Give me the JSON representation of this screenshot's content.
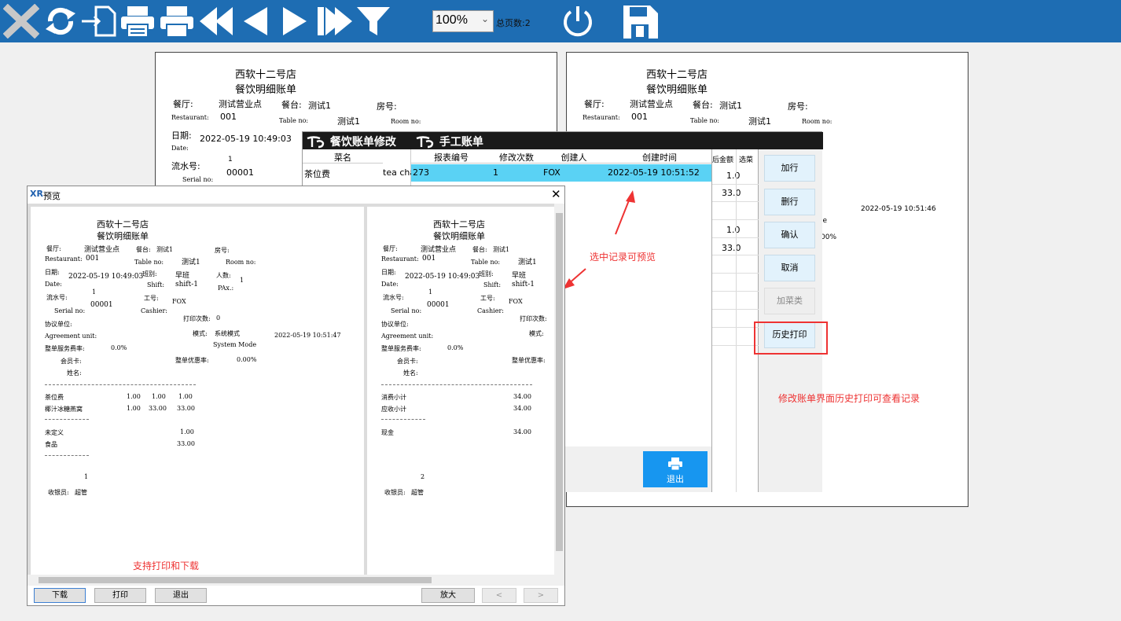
{
  "toolbar": {
    "icons": [
      "close-icon",
      "refresh-icon",
      "export-icon",
      "print-setup-icon",
      "print-icon",
      "first-page-icon",
      "prev-page-icon",
      "next-page-icon",
      "last-page-icon",
      "filter-icon",
      "power-icon",
      "save-icon"
    ],
    "zoom": "100%",
    "total_pages": "总页数:2"
  },
  "receipt": {
    "store": "西软十二号店",
    "title": "餐饮明细账单",
    "restaurant_label": "餐厅:",
    "restaurant_en": "Restaurant:",
    "restaurant": "测试营业点",
    "restaurant_code": "001",
    "table_label": "餐台:",
    "table_en": "Table no:",
    "table": "测试1",
    "room_label": "房号:",
    "room_en": "Room no:",
    "date_label": "日期:",
    "date_en": "Date:",
    "date": "2022-05-19 10:49:03",
    "shift_label": "班别:",
    "shift_en": "Shift:",
    "shift": "早班",
    "shift_code": "shift-1",
    "pax_label": "人数:",
    "pax_en": "PAx.:",
    "pax": "1",
    "serial_label": "流水号:",
    "serial_en": "Serial no:",
    "serial_no": "1",
    "serial_code": "00001",
    "cashier_label": "工号:",
    "cashier_en": "Cashier:",
    "cashier": "FOX",
    "print_count_label": "打印次数:",
    "print_count": "0",
    "agreement_label": "协议单位:",
    "agreement_en": "Agreement unit:",
    "mode_label": "模式:",
    "mode": "系统模式",
    "mode_en": "System Mode",
    "mode_time": "2022-05-19 10:51:47",
    "service_rate_label": "整单服务费率:",
    "service_rate": "0.0%",
    "discount_label": "整单优惠率:",
    "discount": "0.00%",
    "member_label": "会员卡:",
    "name_label": "姓名:",
    "items": [
      {
        "name": "茶位费",
        "qty": "1.00",
        "price": "1.00",
        "amount": "1.00"
      },
      {
        "name": "椰汁冰糖燕窝",
        "qty": "1.00",
        "price": "33.00",
        "amount": "33.00"
      }
    ],
    "groups": [
      {
        "name": "未定义",
        "amount": "1.00"
      },
      {
        "name": "食品",
        "amount": "33.00"
      }
    ],
    "page1_no": "1",
    "cashier_sign_label": "收银员:",
    "cashier_sign": "超管",
    "subtotal_label": "消费小计",
    "subtotal": "34.00",
    "receivable_label": "应收小计",
    "receivable": "34.00",
    "cash_label": "现金",
    "cash": "34.00",
    "page2_no": "2",
    "bg_right_time": "2022-05-19 10:51:46",
    "bg_right_le": "le",
    "bg_right_pct": "00%"
  },
  "edit_window": {
    "tab1": "餐饮账单修改",
    "tab2": "手工账单",
    "col_dish": "菜名",
    "dish_row": "茶位费",
    "dish_en": "tea char",
    "headers": [
      "报表编号",
      "修改次数",
      "创建人",
      "创建时间"
    ],
    "row": [
      "273",
      "1",
      "FOX",
      "2022-05-19 10:51:52"
    ],
    "right_headers": [
      "后金额",
      "选菜"
    ],
    "right_values": [
      "1.0",
      "33.0",
      "1.0",
      "33.0"
    ],
    "buttons": [
      "加行",
      "删行",
      "确认",
      "取消",
      "加菜类",
      "历史打印"
    ],
    "exit": "退出"
  },
  "annotations": {
    "select_preview": "选中记录可预览",
    "history_print": "修改账单界面历史打印可查看记录",
    "support_print": "支持打印和下载"
  },
  "preview": {
    "title": "预览",
    "buttons": [
      "下载",
      "打印",
      "退出",
      "放大",
      "<",
      ">"
    ]
  },
  "colors": {
    "toolbar": "#1e6db3",
    "selected_row": "#5ad2f4",
    "exit_button": "#1796f0",
    "annotation": "#e33333"
  }
}
